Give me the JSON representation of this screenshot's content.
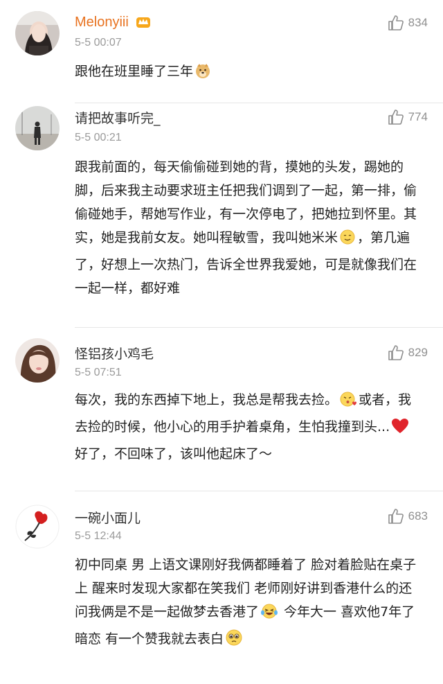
{
  "comments": [
    {
      "username": "Melonyiii",
      "time": "5-5 00:07",
      "likes": "834",
      "text_before": "跟他在班里睡了三年",
      "text_after": ""
    },
    {
      "username": "请把故事听完_",
      "time": "5-5 00:21",
      "likes": "774",
      "text_before": "跟我前面的，每天偷偷碰到她的背，摸她的头发，踢她的脚，后来我主动要求班主任把我们调到了一起，第一排，偷偷碰她手，帮她写作业，有一次停电了，把她拉到怀里。其实，她是我前女友。她叫程敏雪，我叫她米米",
      "text_after": "，第几遍了，好想上一次热门，告诉全世界我爱她，可是就像我们在一起一样，都好难"
    },
    {
      "username": "怪铝孩小鸡毛",
      "time": "5-5 07:51",
      "likes": "829",
      "text_before": "每次，我的东西掉下地上，我总是帮我去捡。",
      "text_middle": "或者，我去捡的时候，他小心的用手护着桌角，生怕我撞到头...",
      "text_after": "好了，不回味了，该叫他起床了～"
    },
    {
      "username": "一碗小面儿",
      "time": "5-5 12:44",
      "likes": "683",
      "text_before": "初中同桌 男 上语文课刚好我俩都睡着了 脸对着脸贴在桌子上 醒来时发现大家都在笑我们 老师刚好讲到香港什么的还问我俩是不是一起做梦去香港了",
      "text_middle": " 今年大一 喜欢他7年了 暗恋 有一个赞我就去表白",
      "text_after": ""
    }
  ]
}
